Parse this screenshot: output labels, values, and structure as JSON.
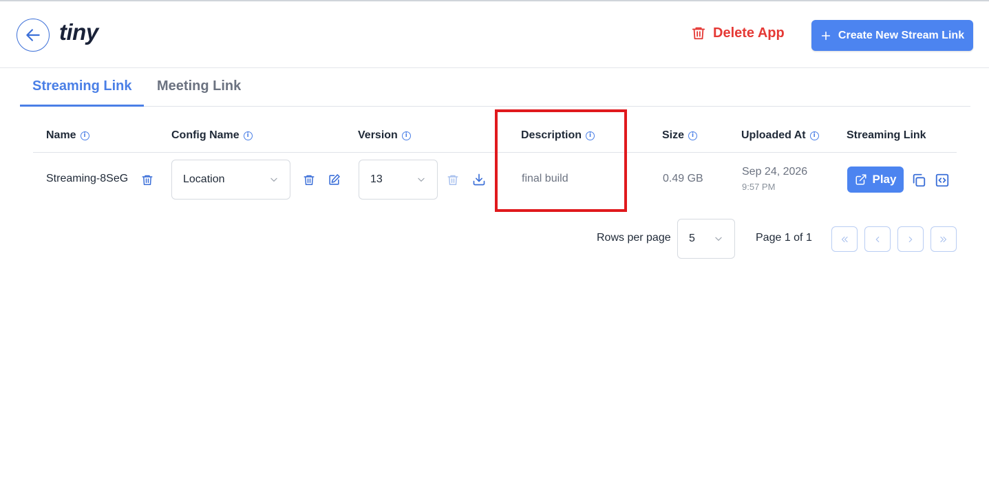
{
  "app": {
    "logo": "tiny"
  },
  "header": {
    "delete_label": "Delete App",
    "create_label": "Create New Stream Link"
  },
  "tabs": [
    {
      "label": "Streaming Link",
      "active": true
    },
    {
      "label": "Meeting Link",
      "active": false
    }
  ],
  "table": {
    "columns": [
      "Name",
      "Config Name",
      "Version",
      "Description",
      "Size",
      "Uploaded At",
      "Streaming Link"
    ],
    "rows": [
      {
        "name": "Streaming-8SeG",
        "config": "Location",
        "version": "13",
        "description": "final build",
        "size": "0.49 GB",
        "uploaded_date": "Sep 24, 2026",
        "uploaded_time": "9:57 PM",
        "play_label": "Play"
      }
    ]
  },
  "pagination": {
    "rows_per_page_label": "Rows per page",
    "rows_per_page": "5",
    "page_label": "Page 1 of 1"
  },
  "colors": {
    "accent": "#4c84f0",
    "danger": "#e53935",
    "highlight": "#e0191d"
  },
  "icons": [
    "back-arrow-icon",
    "trash-icon",
    "plus-icon",
    "info-icon",
    "chevron-down-icon",
    "edit-icon",
    "download-icon",
    "external-link-icon",
    "copy-icon",
    "code-icon",
    "chevrons-left-icon",
    "chevron-left-icon",
    "chevron-right-icon",
    "chevrons-right-icon"
  ]
}
